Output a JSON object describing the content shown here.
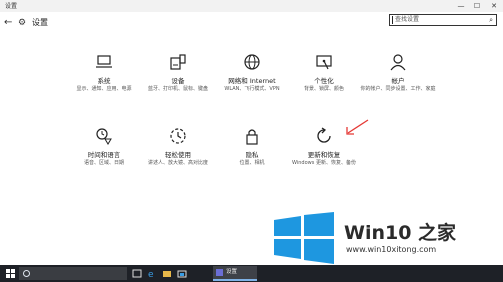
{
  "window": {
    "title": "设置",
    "controls": {
      "minimize": "—",
      "maximize": "☐",
      "close": "✕"
    }
  },
  "header": {
    "title": "设置",
    "back": "←"
  },
  "search": {
    "placeholder": "查找设置"
  },
  "tiles": [
    {
      "name": "系统",
      "desc": "显示、通知、应用、电源"
    },
    {
      "name": "设备",
      "desc": "蓝牙、打印机、鼠标、键盘"
    },
    {
      "name": "网络和 Internet",
      "desc": "WLAN、飞行模式、VPN"
    },
    {
      "name": "个性化",
      "desc": "背景、锁屏、颜色"
    },
    {
      "name": "帐户",
      "desc": "你的帐户、同步设置、工作、家庭"
    },
    {
      "name": "时间和语言",
      "desc": "语音、区域、日期"
    },
    {
      "name": "轻松使用",
      "desc": "讲述人、放大镜、高对比度"
    },
    {
      "name": "隐私",
      "desc": "位置、相机"
    },
    {
      "name": "更新和恢复",
      "desc": "Windows 更新、恢复、备份"
    }
  ],
  "brand": {
    "text": "Win10 之家",
    "url": "www.win10xitong.com"
  },
  "taskbar": {
    "app_label": "设置"
  },
  "colors": {
    "logo_blue": "#1e97e0",
    "arrow_red": "#e53935",
    "taskbar": "#1e2127"
  }
}
